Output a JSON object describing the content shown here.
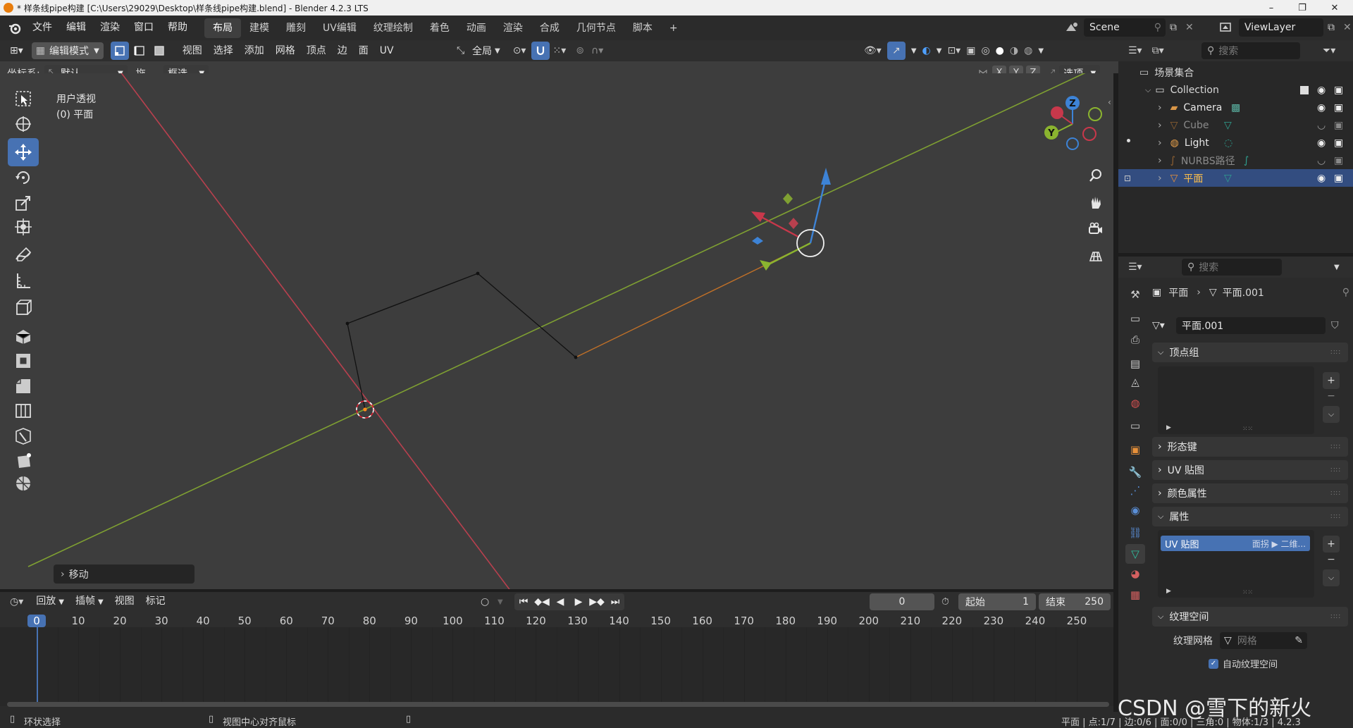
{
  "window": {
    "title": "* 样条线pipe构建 [C:\\Users\\29029\\Desktop\\样条线pipe构建.blend] - Blender 4.2.3 LTS",
    "minimize": "–",
    "maximize": "❐",
    "close": "✕"
  },
  "menus": [
    "文件",
    "编辑",
    "渲染",
    "窗口",
    "帮助"
  ],
  "workspaces": [
    "布局",
    "建模",
    "雕刻",
    "UV编辑",
    "纹理绘制",
    "着色",
    "动画",
    "渲染",
    "合成",
    "几何节点",
    "脚本"
  ],
  "active_workspace": "布局",
  "add_workspace": "+",
  "scene": {
    "name": "Scene"
  },
  "view_layer": {
    "name": "ViewLayer"
  },
  "viewport_header": {
    "mode": "编辑模式",
    "menus": [
      "视图",
      "选择",
      "添加",
      "网格",
      "顶点",
      "边",
      "面",
      "UV"
    ],
    "pivot": "全局"
  },
  "tool_settings": {
    "coord_label": "坐标系:",
    "coord_value": "默认",
    "drag_label": "拖...",
    "select_value": "框选",
    "axes": [
      "X",
      "Y",
      "Z"
    ],
    "options": "选项"
  },
  "overlay_text": {
    "view_name": "用户透视",
    "object_name": "(0) 平面"
  },
  "gizmo_axes": {
    "z": "Z",
    "y": "Y"
  },
  "last_operator": "移动",
  "outliner": {
    "search_placeholder": "搜索",
    "root": "场景集合",
    "collection": "Collection",
    "items": [
      {
        "name": "Camera",
        "type": "camera",
        "hidden": false
      },
      {
        "name": "Cube",
        "type": "mesh",
        "hidden": true
      },
      {
        "name": "Light",
        "type": "light",
        "hidden": false
      },
      {
        "name": "NURBS路径",
        "type": "curve",
        "hidden": true
      },
      {
        "name": "平面",
        "type": "mesh",
        "hidden": false,
        "selected": true
      }
    ]
  },
  "properties": {
    "search_placeholder": "搜索",
    "breadcrumb_object": "平面",
    "breadcrumb_data": "平面.001",
    "datablock": "平面.001",
    "panels": {
      "vertex_groups": "顶点组",
      "shape_keys": "形态键",
      "uv_maps": "UV 贴图",
      "color_attributes": "颜色属性",
      "attributes": "属性",
      "texture_space": "纹理空间"
    },
    "attribute_item": {
      "name": "UV 贴图",
      "domain": "面拐 ▶ 二维..."
    },
    "texture_mesh_label": "纹理网格",
    "texture_mesh_placeholder": "网格",
    "auto_texture_space": "自动纹理空间"
  },
  "timeline": {
    "menus": [
      "回放",
      "插帧",
      "视图",
      "标记"
    ],
    "current_frame": "0",
    "start_label": "起始",
    "start_value": "1",
    "end_label": "结束",
    "end_value": "250",
    "ruler": [
      "0",
      "10",
      "20",
      "30",
      "40",
      "50",
      "60",
      "70",
      "80",
      "90",
      "100",
      "110",
      "120",
      "130",
      "140",
      "150",
      "160",
      "170",
      "180",
      "190",
      "200",
      "210",
      "220",
      "230",
      "240",
      "250"
    ],
    "playhead_frame": 0,
    "frame_range": [
      0,
      250
    ]
  },
  "statusbar": {
    "left": "环状选择",
    "middle": "视图中心对齐鼠标",
    "right": "平面 | 点:1/7 | 边:0/6 | 面:0/0 | 三角:0 | 物体:1/3 | 4.2.3"
  },
  "watermark": "CSDN @雪下的新火",
  "colors": {
    "accent": "#4772b3",
    "x_axis": "#c8384b",
    "y_axis": "#8bb42f",
    "z_axis": "#3d83d6",
    "viewport_bg": "#3d3d3d"
  }
}
